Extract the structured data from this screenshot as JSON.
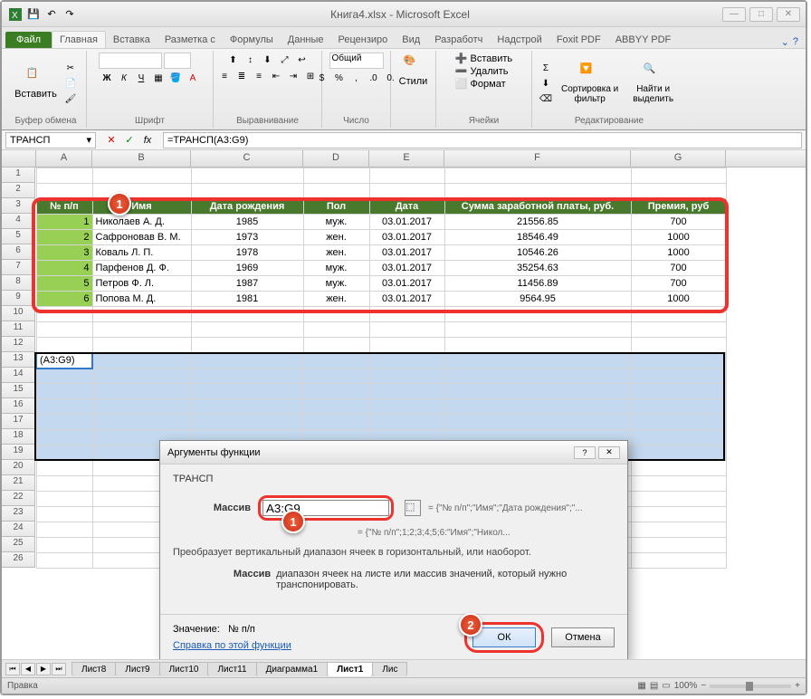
{
  "title": "Книга4.xlsx - Microsoft Excel",
  "file_tab": "Файл",
  "tabs": [
    "Главная",
    "Вставка",
    "Разметка с",
    "Формулы",
    "Данные",
    "Рецензиро",
    "Вид",
    "Разработч",
    "Надстрой",
    "Foxit PDF",
    "ABBYY PDF"
  ],
  "ribbon": {
    "clipboard": {
      "label": "Буфер обмена",
      "paste": "Вставить"
    },
    "font": {
      "label": "Шрифт"
    },
    "alignment": {
      "label": "Выравнивание"
    },
    "number": {
      "label": "Число",
      "format": "Общий"
    },
    "styles": {
      "label": "Стили"
    },
    "cells": {
      "label": "Ячейки",
      "insert": "Вставить",
      "delete": "Удалить",
      "format": "Формат"
    },
    "editing": {
      "label": "Редактирование",
      "sort": "Сортировка и фильтр",
      "find": "Найти и выделить"
    }
  },
  "name_box": "ТРАНСП",
  "formula": "=ТРАНСП(A3:G9)",
  "columns": [
    "A",
    "B",
    "C",
    "D",
    "E",
    "F",
    "G"
  ],
  "rows": [
    "1",
    "2",
    "3",
    "4",
    "5",
    "6",
    "7",
    "8",
    "9",
    "10",
    "11",
    "12",
    "13",
    "14",
    "15",
    "16",
    "17",
    "18",
    "19",
    "20",
    "21",
    "22",
    "23",
    "24",
    "25",
    "26"
  ],
  "table": {
    "headers": [
      "№ п/п",
      "Имя",
      "Дата рождения",
      "Пол",
      "Дата",
      "Сумма заработной платы, руб.",
      "Премия, руб"
    ],
    "rows": [
      {
        "n": "1",
        "name": "Николаев А. Д.",
        "dob": "1985",
        "sex": "муж.",
        "date": "03.01.2017",
        "salary": "21556.85",
        "bonus": "700"
      },
      {
        "n": "2",
        "name": "Сафроновав В. М.",
        "dob": "1973",
        "sex": "жен.",
        "date": "03.01.2017",
        "salary": "18546.49",
        "bonus": "1000"
      },
      {
        "n": "3",
        "name": "Коваль Л. П.",
        "dob": "1978",
        "sex": "жен.",
        "date": "03.01.2017",
        "salary": "10546.26",
        "bonus": "1000"
      },
      {
        "n": "4",
        "name": "Парфенов Д. Ф.",
        "dob": "1969",
        "sex": "муж.",
        "date": "03.01.2017",
        "salary": "35254.63",
        "bonus": "700"
      },
      {
        "n": "5",
        "name": "Петров Ф. Л.",
        "dob": "1987",
        "sex": "муж.",
        "date": "03.01.2017",
        "salary": "11456.89",
        "bonus": "700"
      },
      {
        "n": "6",
        "name": "Попова М. Д.",
        "dob": "1981",
        "sex": "жен.",
        "date": "03.01.2017",
        "salary": "9564.95",
        "bonus": "1000"
      }
    ]
  },
  "sel_cell": "(A3:G9)",
  "sheets": [
    "Лист8",
    "Лист9",
    "Лист10",
    "Лист11",
    "Диаграмма1",
    "Лист1",
    "Лис"
  ],
  "active_sheet": "Лист1",
  "status": "Правка",
  "zoom": "100%",
  "dialog": {
    "title": "Аргументы функции",
    "fn": "ТРАНСП",
    "arg_label": "Массив",
    "arg_value": "A3:G9",
    "arg_eval": "= {\"№ п/п\";\"Имя\";\"Дата рождения\";\"...",
    "result_eval": "= {\"№ п/п\";1;2;3;4;5;6:\"Имя\";\"Никол...",
    "desc": "Преобразует вертикальный диапазон ячеек в горизонтальный, или наоборот.",
    "arg_name": "Массив",
    "arg_desc": "диапазон ячеек на листе или массив значений, который нужно транспонировать.",
    "value_label": "Значение:",
    "value": "№ п/п",
    "help": "Справка по этой функции",
    "ok": "ОК",
    "cancel": "Отмена"
  },
  "badges": {
    "1": "1",
    "2": "2"
  }
}
